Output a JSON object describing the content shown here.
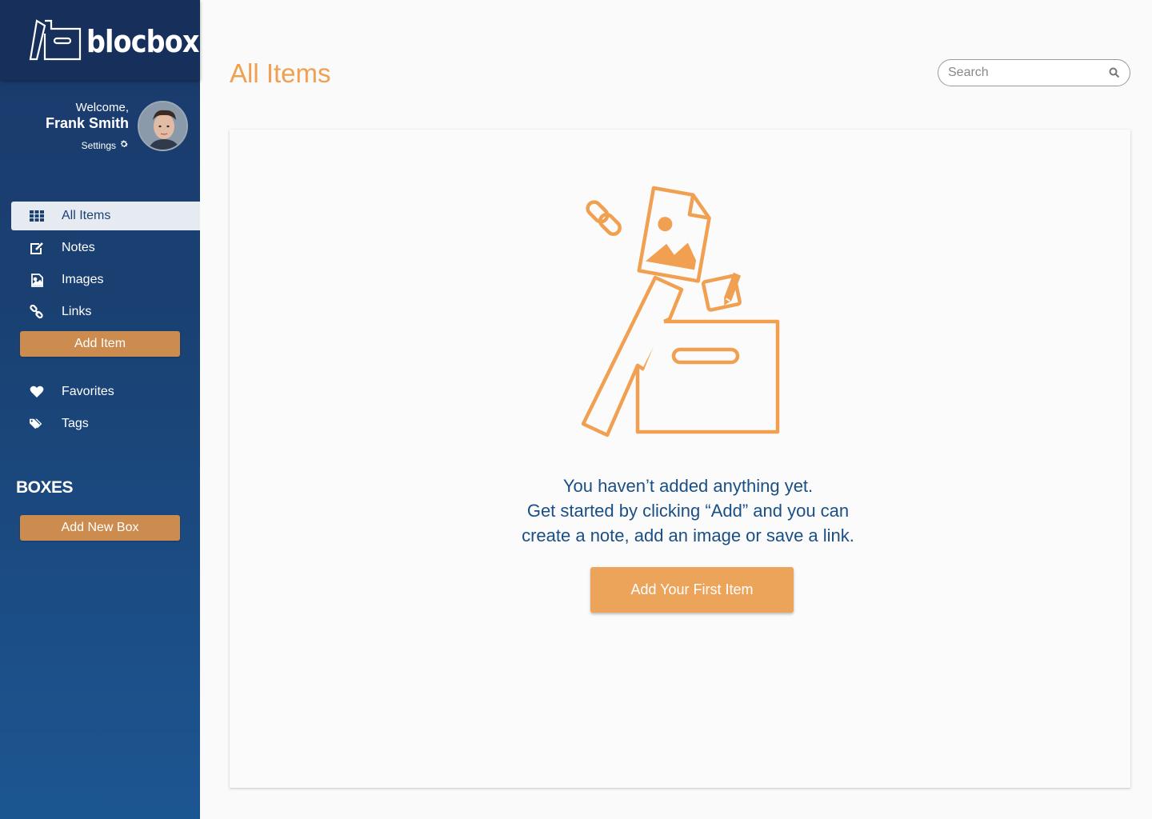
{
  "brand": {
    "name": "blocbox"
  },
  "user": {
    "welcome": "Welcome,",
    "name": "Frank Smith",
    "settings_label": "Settings"
  },
  "nav": {
    "items": [
      {
        "label": "All Items",
        "icon": "grid-icon",
        "active": true
      },
      {
        "label": "Notes",
        "icon": "edit-icon"
      },
      {
        "label": "Images",
        "icon": "image-file-icon"
      },
      {
        "label": "Links",
        "icon": "link-icon"
      }
    ],
    "add_item_label": "Add Item",
    "secondary": [
      {
        "label": "Favorites",
        "icon": "heart-icon"
      },
      {
        "label": "Tags",
        "icon": "tags-icon"
      }
    ]
  },
  "boxes": {
    "heading": "BOXES",
    "add_label": "Add New Box"
  },
  "header": {
    "title": "All Items"
  },
  "search": {
    "placeholder": "Search"
  },
  "empty_state": {
    "line1": "You haven’t added anything yet.",
    "line2": "Get started by clicking “Add” and you can",
    "line3": "create a note, add an image or save a link.",
    "cta_label": "Add Your First Item"
  },
  "colors": {
    "sidebar_top": "#172f5b",
    "sidebar_bottom": "#1c5692",
    "accent_orange": "#f0a050",
    "button_orange": "#cd8c4f",
    "text_blue": "#1a4f86"
  }
}
